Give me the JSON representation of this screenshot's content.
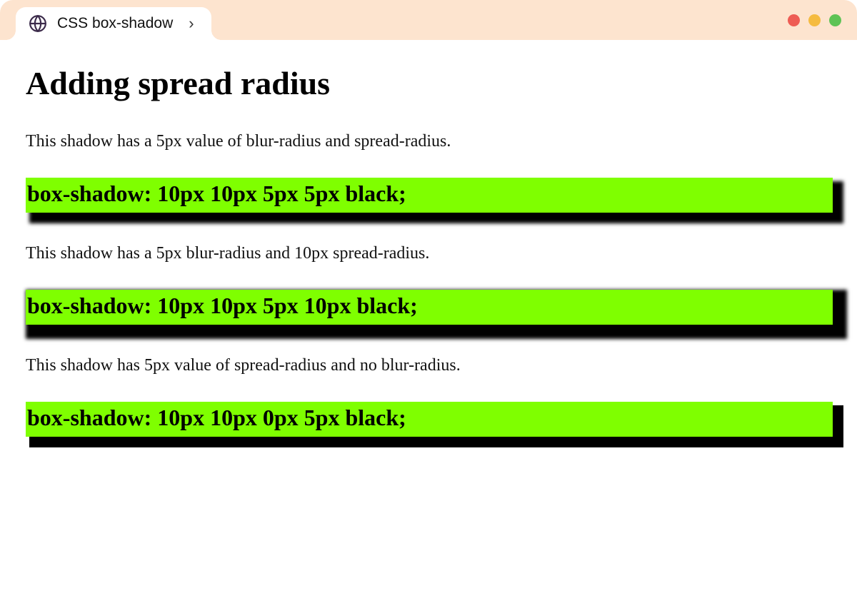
{
  "browser": {
    "tab_title": "CSS box-shadow"
  },
  "page_title": "Adding spread radius",
  "examples": [
    {
      "description": "This shadow has a 5px value of blur-radius and spread-radius.",
      "code": "box-shadow: 10px 10px 5px 5px black;"
    },
    {
      "description": "This shadow has a 5px blur-radius and 10px spread-radius.",
      "code": "box-shadow: 10px 10px 5px 10px black;"
    },
    {
      "description": "This shadow has 5px value of spread-radius and no blur-radius.",
      "code": "box-shadow: 10px 10px 0px 5px black;"
    }
  ],
  "colors": {
    "chrome_bg": "#fde4cf",
    "example_bg": "#7fff00",
    "traffic_red": "#ee5c54",
    "traffic_yellow": "#f5bb40",
    "traffic_green": "#5ec355"
  }
}
